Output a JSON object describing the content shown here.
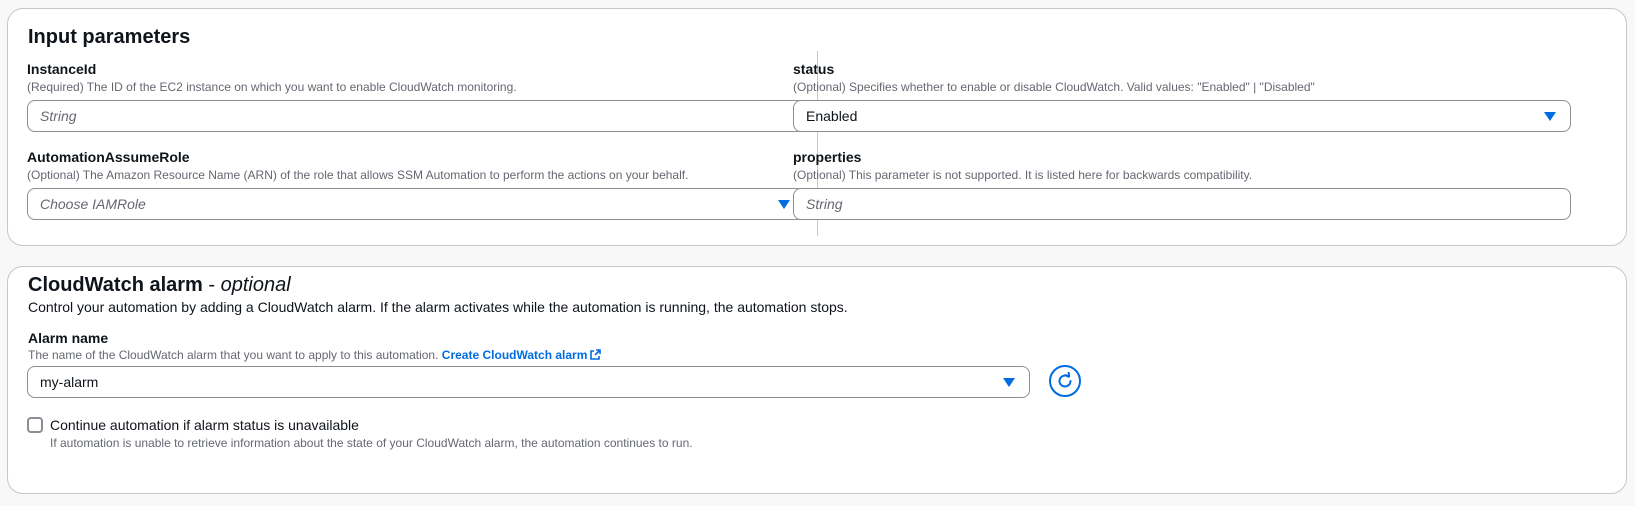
{
  "input_parameters": {
    "title": "Input parameters",
    "instance_id": {
      "label": "InstanceId",
      "description": "(Required) The ID of the EC2 instance on which you want to enable CloudWatch monitoring.",
      "placeholder": "String"
    },
    "status": {
      "label": "status",
      "description": "(Optional) Specifies whether to enable or disable CloudWatch. Valid values: \"Enabled\" | \"Disabled\"",
      "value": "Enabled"
    },
    "automation_assume_role": {
      "label": "AutomationAssumeRole",
      "description": "(Optional) The Amazon Resource Name (ARN) of the role that allows SSM Automation to perform the actions on your behalf.",
      "placeholder": "Choose IAMRole"
    },
    "properties": {
      "label": "properties",
      "description": "(Optional) This parameter is not supported. It is listed here for backwards compatibility.",
      "placeholder": "String"
    }
  },
  "cloudwatch_alarm": {
    "title": "CloudWatch alarm",
    "title_suffix": "optional",
    "title_dash": " - ",
    "description": "Control your automation by adding a CloudWatch alarm. If the alarm activates while the automation is running, the automation stops.",
    "alarm_name": {
      "label": "Alarm name",
      "description": "The name of the CloudWatch alarm that you want to apply to this automation.",
      "link_text": "Create CloudWatch alarm",
      "value": "my-alarm"
    },
    "continue_checkbox": {
      "label": "Continue automation if alarm status is unavailable",
      "description": "If automation is unable to retrieve information about the state of your CloudWatch alarm, the automation continues to run.",
      "checked": false
    }
  },
  "colors": {
    "accent": "#006ce0",
    "border": "#c6c6cd",
    "text": "#0f141a",
    "muted": "#656871"
  },
  "icons": [
    "caret-down-icon",
    "external-link-icon",
    "refresh-icon"
  ]
}
